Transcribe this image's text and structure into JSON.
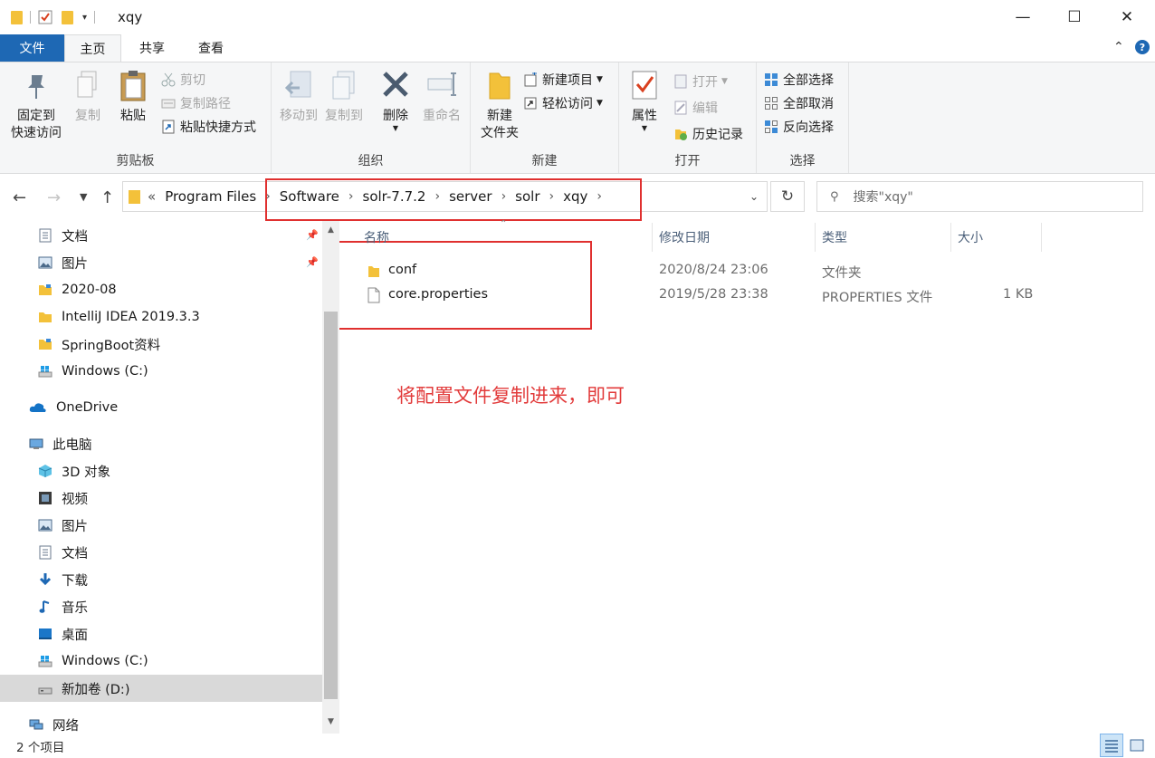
{
  "window": {
    "title": "xqy",
    "minimize": "—",
    "maximize": "☐",
    "close": "✕"
  },
  "ribbon_tabs": {
    "file": "文件",
    "home": "主页",
    "share": "共享",
    "view": "查看",
    "collapse": "⌃",
    "help": "?"
  },
  "ribbon": {
    "clipboard": {
      "pin_line1": "固定到",
      "pin_line2": "快速访问",
      "copy": "复制",
      "paste": "粘贴",
      "cut": "剪切",
      "copy_path": "复制路径",
      "paste_shortcut": "粘贴快捷方式",
      "label": "剪贴板"
    },
    "organize": {
      "move_to": "移动到",
      "copy_to": "复制到",
      "delete": "删除",
      "rename": "重命名",
      "label": "组织"
    },
    "new": {
      "new_folder_line1": "新建",
      "new_folder_line2": "文件夹",
      "new_item": "新建项目",
      "easy_access": "轻松访问",
      "label": "新建"
    },
    "open": {
      "properties": "属性",
      "open": "打开",
      "edit": "编辑",
      "history": "历史记录",
      "label": "打开"
    },
    "select": {
      "select_all": "全部选择",
      "select_none": "全部取消",
      "invert": "反向选择",
      "label": "选择"
    }
  },
  "address": {
    "overflow": "«",
    "crumbs": [
      "Program Files",
      "Software",
      "solr-7.7.2",
      "server",
      "solr",
      "xqy"
    ],
    "separator": "›",
    "search_placeholder": "搜索\"xqy\""
  },
  "nav": {
    "items": [
      {
        "label": "文档",
        "icon": "document-icon"
      },
      {
        "label": "图片",
        "icon": "picture-icon"
      },
      {
        "label": "2020-08",
        "icon": "folder-icon"
      },
      {
        "label": "IntelliJ IDEA 2019.3.3",
        "icon": "folder-icon"
      },
      {
        "label": "SpringBoot资料",
        "icon": "folder-icon"
      },
      {
        "label": "Windows (C:)",
        "icon": "drive-icon"
      },
      {
        "label": "OneDrive",
        "icon": "cloud-icon"
      },
      {
        "label": "此电脑",
        "icon": "computer-icon"
      },
      {
        "label": "3D 对象",
        "icon": "cube-icon"
      },
      {
        "label": "视频",
        "icon": "video-icon"
      },
      {
        "label": "图片",
        "icon": "picture-icon"
      },
      {
        "label": "文档",
        "icon": "document-icon"
      },
      {
        "label": "下载",
        "icon": "download-icon"
      },
      {
        "label": "音乐",
        "icon": "music-icon"
      },
      {
        "label": "桌面",
        "icon": "desktop-icon"
      },
      {
        "label": "Windows (C:)",
        "icon": "drive-icon"
      },
      {
        "label": "新加卷 (D:)",
        "icon": "drive-icon"
      },
      {
        "label": "网络",
        "icon": "network-icon"
      }
    ],
    "pin": "📌"
  },
  "columns": {
    "name": "名称",
    "modified": "修改日期",
    "type": "类型",
    "size": "大小"
  },
  "files": [
    {
      "name": "conf",
      "modified": "2020/8/24 23:06",
      "type": "文件夹",
      "size": "",
      "icon": "folder-icon"
    },
    {
      "name": "core.properties",
      "modified": "2019/5/28 23:38",
      "type": "PROPERTIES 文件",
      "size": "1 KB",
      "icon": "file-icon"
    }
  ],
  "annotation": "将配置文件复制进来，即可",
  "status": {
    "item_count": "2 个项目"
  },
  "colors": {
    "accent": "#1e68b4",
    "folder": "#f3c13a",
    "annotation_red": "#e23b3b",
    "highlight_box": "#e0302f"
  }
}
